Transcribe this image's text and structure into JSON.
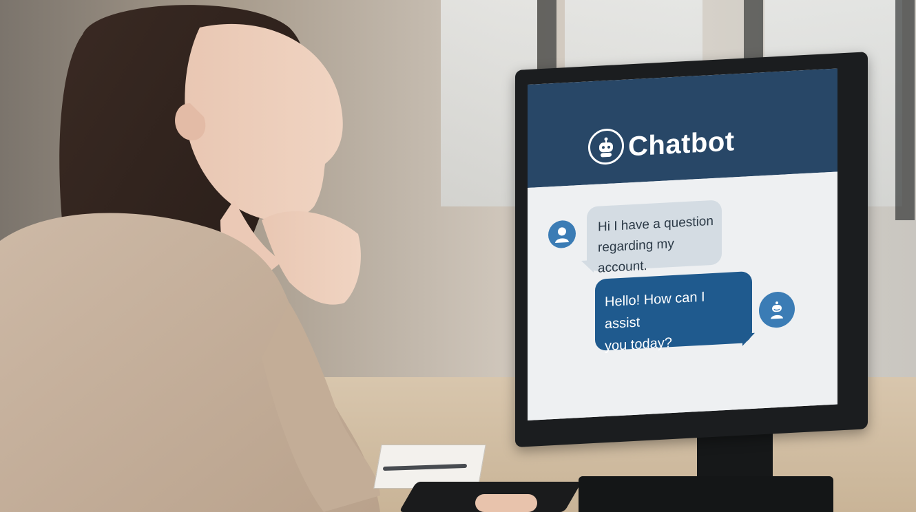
{
  "screen": {
    "title": "Chatbot",
    "messages": [
      {
        "from": "user",
        "text_line1": "Hi  I have a question",
        "text_line2": "regarding my account."
      },
      {
        "from": "bot",
        "text_line1": "Hello! How can I assist",
        "text_line2": "you today?"
      }
    ]
  },
  "colors": {
    "header_bg": "#284767",
    "user_bubble_bg": "#d4dce3",
    "bot_bubble_bg": "#1f5a8e",
    "avatar_bg": "#3b7cb5"
  },
  "icons": {
    "logo": "robot-icon",
    "user_avatar": "user-avatar-icon",
    "bot_avatar": "robot-avatar-icon"
  }
}
